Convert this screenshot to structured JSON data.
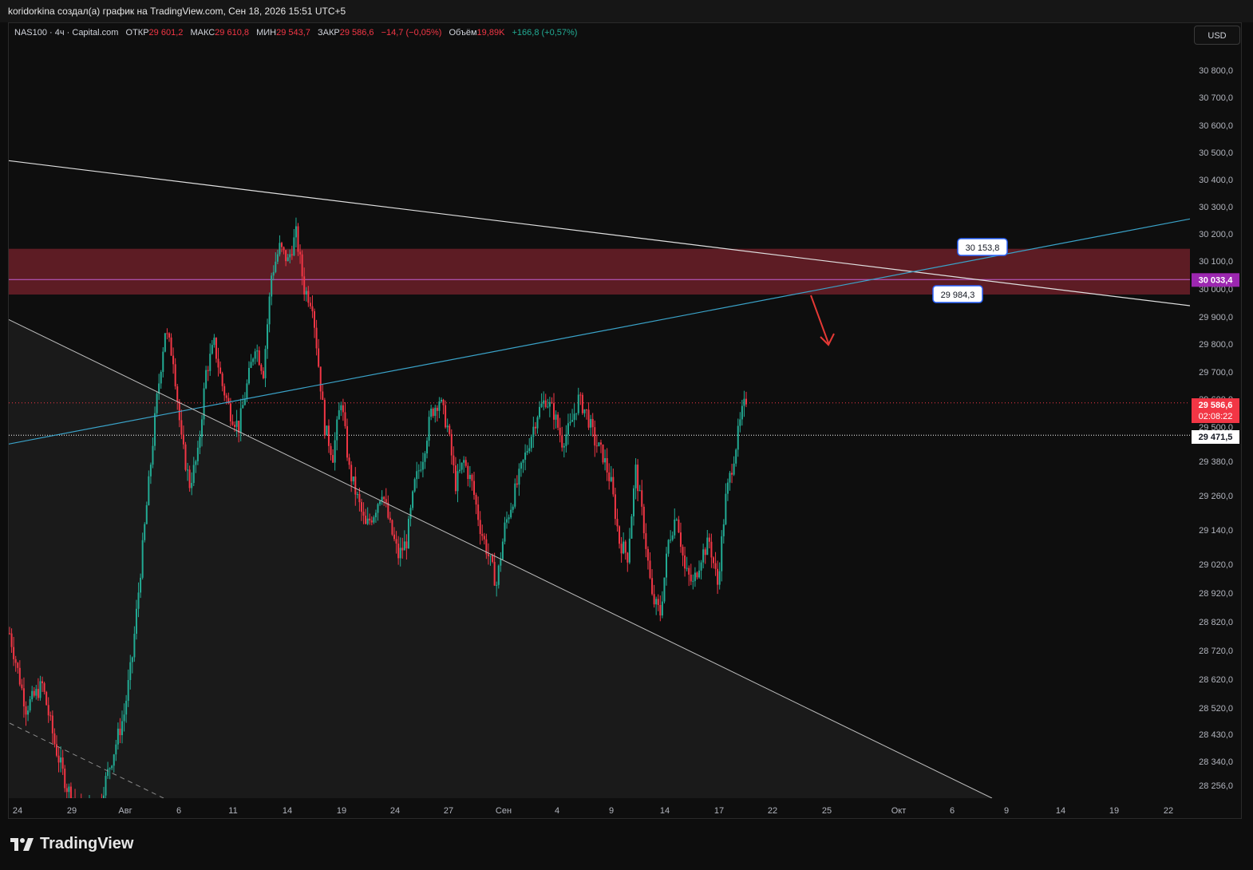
{
  "header": {
    "caption": "koridorkina создал(а) график на TradingView.com, Сен 18, 2026 15:51 UTC+5"
  },
  "legend": {
    "symbol": "NAS100 · 4ч · Capital.com",
    "open_label": "ОТКР",
    "open_value": "29 601,2",
    "high_label": "МАКС",
    "high_value": "29 610,8",
    "low_label": "МИН",
    "low_value": "29 543,7",
    "close_label": "ЗАКР",
    "close_value": "29 586,6",
    "change": "−14,7 (−0,05%)",
    "volume_label": "Объём",
    "volume_value": "19,89K",
    "volume_change": "+166,8 (+0,57%)"
  },
  "currency_button": "USD",
  "footer": {
    "brand": "TradingView"
  },
  "colors": {
    "up": "#22ab94",
    "down": "#f23645",
    "zone": "#6b1f28",
    "blue_line": "#3aa3c9",
    "purple": "#9c27b0"
  },
  "chart_data": {
    "type": "candlestick",
    "symbol": "NAS100",
    "timeframe": "4ч",
    "y_axis": {
      "ticks": [
        "30 800,0",
        "30 700,0",
        "30 600,0",
        "30 500,0",
        "30 400,0",
        "30 300,0",
        "30 200,0",
        "30 100,0",
        "30 000,0",
        "29 900,0",
        "29 800,0",
        "29 700,0",
        "29 600,0",
        "29 500,0",
        "29 380,0",
        "29 260,0",
        "29 140,0",
        "29 020,0",
        "28 920,0",
        "28 820,0",
        "28 720,0",
        "28 620,0",
        "28 520,0",
        "28 430,0",
        "28 340,0",
        "28 256,0"
      ],
      "tick_values": [
        30800,
        30700,
        30600,
        30500,
        30400,
        30300,
        30200,
        30100,
        30000,
        29900,
        29800,
        29700,
        29600,
        29500,
        29380,
        29260,
        29140,
        29020,
        28920,
        28820,
        28720,
        28620,
        28520,
        28430,
        28340,
        28256
      ],
      "scale": "non-uniform"
    },
    "x_axis": {
      "ticks": [
        "24",
        "29",
        "Авг",
        "6",
        "11",
        "14",
        "19",
        "24",
        "27",
        "Сен",
        "4",
        "9",
        "14",
        "17",
        "22",
        "25",
        "Окт",
        "6",
        "9",
        "14",
        "19",
        "22"
      ]
    },
    "price_labels": [
      {
        "name": "last-price",
        "value": "29 586,6",
        "countdown": "02:08:22",
        "color": "#f23645"
      },
      {
        "name": "horizontal-line",
        "value": "30 033,4",
        "color": "#9c27b0"
      },
      {
        "name": "dotted-level",
        "value": "29 471,5",
        "color": "#ffffff"
      }
    ],
    "annotations": [
      {
        "name": "upper-label",
        "text": "30 153,8"
      },
      {
        "name": "lower-label",
        "text": "29 984,3"
      }
    ],
    "zone": {
      "from": 29980,
      "to": 30145
    },
    "trendlines": [
      {
        "name": "resistance-line",
        "color": "#e0e0e0",
        "from": [
          0,
          30470
        ],
        "to": [
          1,
          29940
        ]
      },
      {
        "name": "ascending-line",
        "color": "#3aa3c9",
        "from": [
          0,
          29440
        ],
        "to": [
          1,
          30255
        ]
      },
      {
        "name": "descending-support-line",
        "color": "#bdbdbd",
        "from": [
          0,
          29890
        ],
        "to": [
          1,
          28250
        ]
      }
    ],
    "horizontal_levels": [
      {
        "name": "purple-level",
        "value": 30033.4
      },
      {
        "name": "dotted-white-level",
        "value": 29471.5
      },
      {
        "name": "dotted-red-level",
        "value": 29586.6
      }
    ],
    "anchors": [
      [
        0,
        28780
      ],
      [
        8,
        28520
      ],
      [
        16,
        28600
      ],
      [
        22,
        28400
      ],
      [
        28,
        28250
      ],
      [
        36,
        28150
      ],
      [
        44,
        28200
      ],
      [
        50,
        28350
      ],
      [
        56,
        28500
      ],
      [
        60,
        28700
      ],
      [
        64,
        29000
      ],
      [
        68,
        29300
      ],
      [
        72,
        29600
      ],
      [
        76,
        29850
      ],
      [
        80,
        29750
      ],
      [
        84,
        29450
      ],
      [
        88,
        29300
      ],
      [
        92,
        29400
      ],
      [
        96,
        29700
      ],
      [
        100,
        29800
      ],
      [
        104,
        29650
      ],
      [
        108,
        29550
      ],
      [
        112,
        29500
      ],
      [
        116,
        29650
      ],
      [
        120,
        29800
      ],
      [
        124,
        29700
      ],
      [
        128,
        30050
      ],
      [
        132,
        30150
      ],
      [
        136,
        30100
      ],
      [
        140,
        30200
      ],
      [
        144,
        30000
      ],
      [
        148,
        29950
      ],
      [
        150,
        29800
      ],
      [
        154,
        29500
      ],
      [
        158,
        29400
      ],
      [
        162,
        29600
      ],
      [
        166,
        29350
      ],
      [
        170,
        29250
      ],
      [
        174,
        29150
      ],
      [
        178,
        29200
      ],
      [
        182,
        29280
      ],
      [
        186,
        29150
      ],
      [
        190,
        29050
      ],
      [
        194,
        29100
      ],
      [
        198,
        29300
      ],
      [
        202,
        29400
      ],
      [
        206,
        29550
      ],
      [
        210,
        29600
      ],
      [
        214,
        29500
      ],
      [
        218,
        29300
      ],
      [
        222,
        29380
      ],
      [
        226,
        29300
      ],
      [
        230,
        29150
      ],
      [
        234,
        29050
      ],
      [
        238,
        28950
      ],
      [
        242,
        29150
      ],
      [
        246,
        29250
      ],
      [
        250,
        29350
      ],
      [
        254,
        29450
      ],
      [
        258,
        29550
      ],
      [
        262,
        29600
      ],
      [
        266,
        29550
      ],
      [
        270,
        29450
      ],
      [
        274,
        29500
      ],
      [
        278,
        29600
      ],
      [
        282,
        29550
      ],
      [
        286,
        29450
      ],
      [
        290,
        29400
      ],
      [
        294,
        29300
      ],
      [
        298,
        29100
      ],
      [
        302,
        29050
      ],
      [
        306,
        29350
      ],
      [
        310,
        29150
      ],
      [
        314,
        28900
      ],
      [
        318,
        28850
      ],
      [
        322,
        29100
      ],
      [
        326,
        29200
      ],
      [
        330,
        29000
      ],
      [
        334,
        28950
      ],
      [
        338,
        29050
      ],
      [
        342,
        29100
      ],
      [
        346,
        28950
      ],
      [
        350,
        29250
      ],
      [
        354,
        29400
      ],
      [
        358,
        29550
      ],
      [
        360,
        29600
      ]
    ]
  }
}
